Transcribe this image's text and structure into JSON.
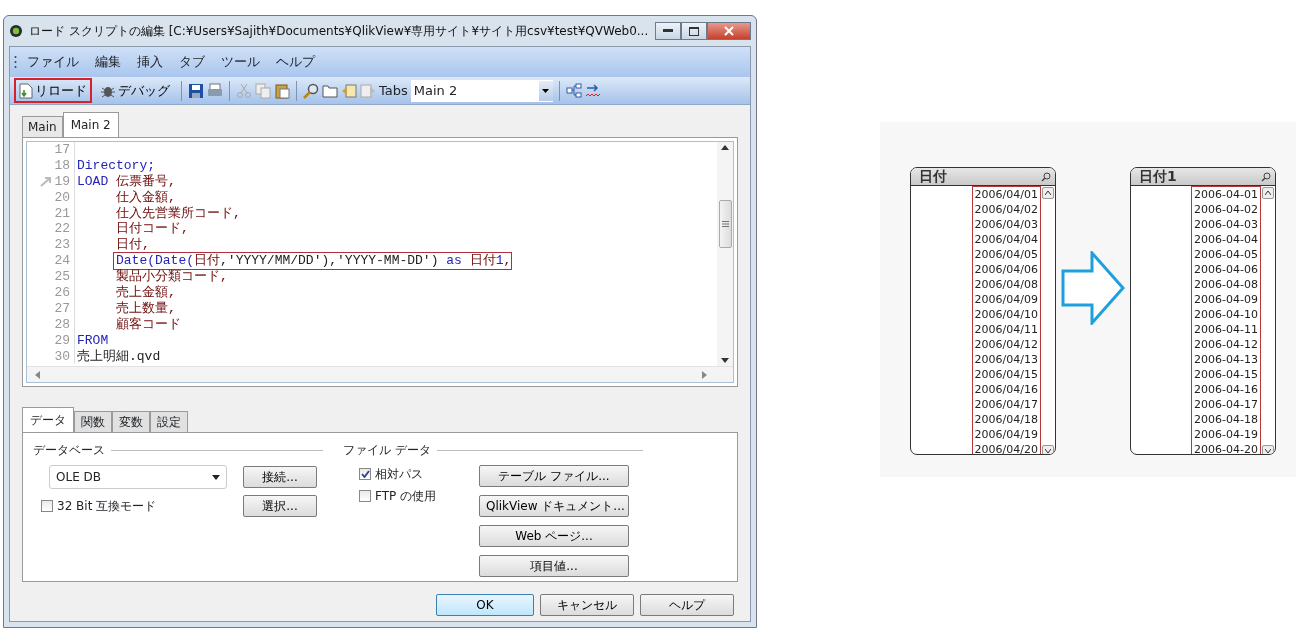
{
  "window": {
    "title": "ロード スクリプトの編集 [C:¥Users¥Sajith¥Documents¥QlikView¥専用サイト¥サイト用csv¥test¥QVWeb0..."
  },
  "menu": [
    "ファイル",
    "編集",
    "挿入",
    "タブ",
    "ツール",
    "ヘルプ"
  ],
  "toolbar": {
    "reload": {
      "label": "リロード",
      "highlighted": true
    },
    "debug": {
      "label": "デバッグ"
    },
    "tabs_label": "Tabs",
    "tabs_value": "Main 2"
  },
  "script_tabs": [
    {
      "label": "Main",
      "selected": false
    },
    {
      "label": "Main 2",
      "selected": true
    }
  ],
  "code_lines": [
    {
      "number": "17"
    },
    {
      "number": "18",
      "tokens": [
        {
          "text": "Directory;",
          "kind": "keyword"
        }
      ]
    },
    {
      "number": "19",
      "bookmark": true,
      "tokens": [
        {
          "text": "LOAD",
          "kind": "keyword"
        },
        {
          "text": " 伝票番号,",
          "kind": "field"
        }
      ]
    },
    {
      "number": "20",
      "tokens": [
        {
          "text": "     仕入金額,",
          "kind": "field"
        }
      ]
    },
    {
      "number": "21",
      "tokens": [
        {
          "text": "     仕入先営業所コード,",
          "kind": "field"
        }
      ]
    },
    {
      "number": "22",
      "tokens": [
        {
          "text": "     日付コード,",
          "kind": "field"
        }
      ]
    },
    {
      "number": "23",
      "tokens": [
        {
          "text": "     日付,",
          "kind": "field"
        }
      ]
    },
    {
      "number": "24",
      "highlighted": true,
      "tokens": [
        {
          "text": "     Date(Date(",
          "kind": "keyword"
        },
        {
          "text": "日付",
          "kind": "field"
        },
        {
          "text": ",'YYYY/MM/DD'),'YYYY-MM-DD') ",
          "kind": "plain"
        },
        {
          "text": "as",
          "kind": "keyword"
        },
        {
          "text": " 日付",
          "kind": "field"
        },
        {
          "text": "1",
          "kind": "keyword"
        },
        {
          "text": ",",
          "kind": "field"
        }
      ]
    },
    {
      "number": "25",
      "tokens": [
        {
          "text": "     製品小分類コード,",
          "kind": "field"
        }
      ]
    },
    {
      "number": "26",
      "tokens": [
        {
          "text": "     売上金額,",
          "kind": "field"
        }
      ]
    },
    {
      "number": "27",
      "tokens": [
        {
          "text": "     売上数量,",
          "kind": "field"
        }
      ]
    },
    {
      "number": "28",
      "tokens": [
        {
          "text": "     顧客コード",
          "kind": "field"
        }
      ]
    },
    {
      "number": "29",
      "tokens": [
        {
          "text": "FROM",
          "kind": "keyword"
        }
      ]
    },
    {
      "number": "30",
      "tokens": [
        {
          "text": "売上明細.qvd",
          "kind": "plain"
        }
      ]
    }
  ],
  "bottom_tabs": [
    {
      "label": "データ",
      "selected": true
    },
    {
      "label": "関数",
      "selected": false
    },
    {
      "label": "変数",
      "selected": false
    },
    {
      "label": "設定",
      "selected": false
    }
  ],
  "database": {
    "legend": "データベース",
    "select_value": "OLE DB",
    "connect": "接続...",
    "choose": "選択...",
    "compat": {
      "label": "32 Bit 互換モード",
      "checked": false
    }
  },
  "file_data": {
    "legend": "ファイル データ",
    "checkboxes": [
      {
        "label": "相対パス",
        "checked": true
      },
      {
        "label": "FTP の使用",
        "checked": false
      }
    ],
    "buttons": [
      "テーブル ファイル...",
      "QlikView ドキュメント...",
      "Web ページ...",
      "項目値..."
    ]
  },
  "footer_buttons": [
    {
      "label": "OK",
      "default": true
    },
    {
      "label": "キャンセル",
      "default": false
    },
    {
      "label": "ヘルプ",
      "default": false
    }
  ],
  "listboxes": [
    {
      "title": "日付",
      "values": [
        "2006/04/01",
        "2006/04/02",
        "2006/04/03",
        "2006/04/04",
        "2006/04/05",
        "2006/04/06",
        "2006/04/08",
        "2006/04/09",
        "2006/04/10",
        "2006/04/11",
        "2006/04/12",
        "2006/04/13",
        "2006/04/15",
        "2006/04/16",
        "2006/04/17",
        "2006/04/18",
        "2006/04/19",
        "2006/04/20"
      ]
    },
    {
      "title": "日付1",
      "values": [
        "2006-04-01",
        "2006-04-02",
        "2006-04-03",
        "2006-04-04",
        "2006-04-05",
        "2006-04-06",
        "2006-04-08",
        "2006-04-09",
        "2006-04-10",
        "2006-04-11",
        "2006-04-12",
        "2006-04-13",
        "2006-04-15",
        "2006-04-16",
        "2006-04-17",
        "2006-04-18",
        "2006-04-19",
        "2006-04-20"
      ]
    }
  ]
}
